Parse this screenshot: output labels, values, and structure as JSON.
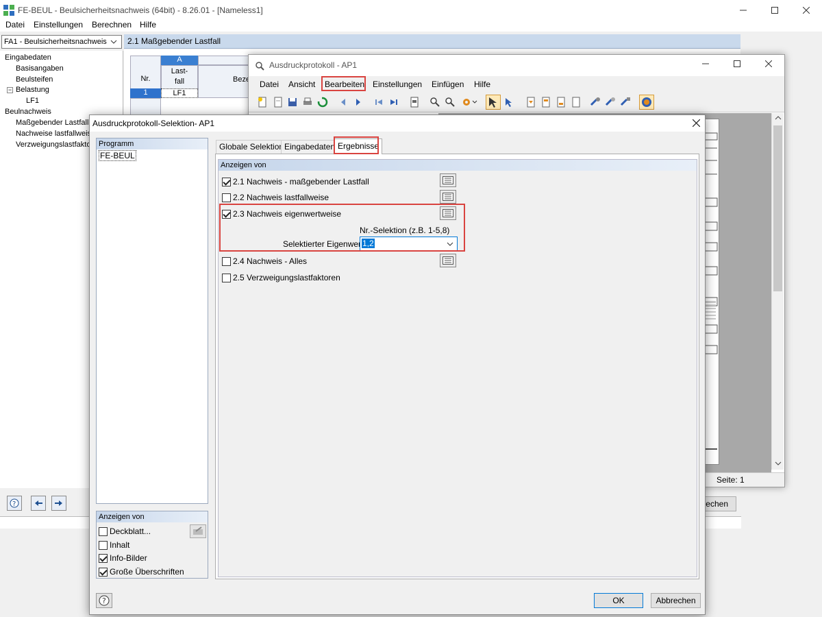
{
  "app": {
    "title": "FE-BEUL - Beulsicherheitsnachweis (64bit) - 8.26.01 - [Nameless1]",
    "menu": [
      "Datei",
      "Einstellungen",
      "Berechnen",
      "Hilfe"
    ]
  },
  "navigator": {
    "case_select": "FA1 - Beulsicherheitsnachweis",
    "items": [
      "Eingabedaten",
      "Basisangaben",
      "Beulsteifen",
      "Belastung",
      "LF1",
      "Beulnachweis",
      "Maßgebender Lastfall",
      "Nachweise lastfallweis",
      "Verzweigungslastfakto"
    ]
  },
  "main": {
    "table_title": "2.1 Maßgebender Lastfall",
    "col_letter": "A",
    "col_nr": "Nr.",
    "col_lastfall_1": "Last-",
    "col_lastfall_2": "fall",
    "col_bez": "Beze",
    "row_nr": "1",
    "row_lf": "LF1",
    "bg_cancel_partial": "rechen"
  },
  "printout": {
    "title": "Ausdruckprotokoll - AP1",
    "menu": [
      "Datei",
      "Ansicht",
      "Bearbeiten",
      "Einstellungen",
      "Einfügen",
      "Hilfe"
    ],
    "status_page": "Seite: 1"
  },
  "dialog": {
    "title": "Ausdruckprotokoll-Selektion- AP1",
    "programm_header": "Programm",
    "programm_item": "FE-BEUL",
    "anzeigen_header": "Anzeigen von",
    "left_options": [
      {
        "label": "Deckblatt...",
        "checked": false
      },
      {
        "label": "Inhalt",
        "checked": false
      },
      {
        "label": "Info-Bilder",
        "checked": true
      },
      {
        "label": "Große Überschriften",
        "checked": true
      }
    ],
    "tabs": [
      "Globale Selektion",
      "Eingabedaten",
      "Ergebnisse"
    ],
    "active_tab": "Ergebnisse",
    "section_header": "Anzeigen von",
    "results": [
      {
        "label": "2.1 Nachweis - maßgebender Lastfall",
        "checked": true
      },
      {
        "label": "2.2 Nachweis lastfallweise",
        "checked": false
      },
      {
        "label": "2.3 Nachweis eigenwertweise",
        "checked": true
      },
      {
        "label": "2.4 Nachweis - Alles",
        "checked": false
      },
      {
        "label": "2.5 Verzweigungslastfaktoren",
        "checked": false
      }
    ],
    "nr_selection_hint": "Nr.-Selektion (z.B. 1-5,8)",
    "eigenwert_label": "Selektierter Eigenwert:",
    "eigenwert_value": "1,2",
    "ok_label": "OK",
    "cancel_label": "Abbrechen"
  },
  "colors": {
    "highlight": "#d9433f",
    "header_blue": "#c9d9ec",
    "selection_blue": "#0078d7"
  }
}
